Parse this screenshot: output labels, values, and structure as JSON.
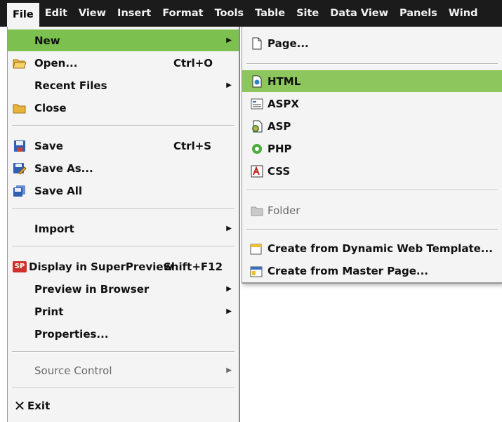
{
  "menubar": {
    "items": [
      "File",
      "Edit",
      "View",
      "Insert",
      "Format",
      "Tools",
      "Table",
      "Site",
      "Data View",
      "Panels",
      "Wind"
    ]
  },
  "file_menu": {
    "new": {
      "label": "New"
    },
    "open": {
      "label": "Open...",
      "shortcut": "Ctrl+O",
      "icon": "folder-open-icon"
    },
    "recent": {
      "label": "Recent Files"
    },
    "close": {
      "label": "Close",
      "icon": "folder-close-icon"
    },
    "save": {
      "label": "Save",
      "shortcut": "Ctrl+S",
      "icon": "floppy-disk-icon"
    },
    "save_as": {
      "label": "Save As...",
      "icon": "save-as-icon"
    },
    "save_all": {
      "label": "Save All",
      "icon": "save-all-icon"
    },
    "import": {
      "label": "Import"
    },
    "superpreview": {
      "label": "Display in SuperPreview",
      "shortcut": "Shift+F12",
      "icon": "superpreview-icon",
      "icon_text": "SP"
    },
    "preview": {
      "label": "Preview in Browser"
    },
    "print": {
      "label": "Print"
    },
    "properties": {
      "label": "Properties..."
    },
    "source_control": {
      "label": "Source Control"
    },
    "exit": {
      "label": "Exit",
      "icon": "close-x-icon"
    }
  },
  "new_submenu": {
    "page": {
      "label": "Page...",
      "icon": "page-icon"
    },
    "html": {
      "label": "HTML",
      "icon": "html-file-icon"
    },
    "aspx": {
      "label": "ASPX",
      "icon": "aspx-file-icon"
    },
    "asp": {
      "label": "ASP",
      "icon": "asp-file-icon"
    },
    "php": {
      "label": "PHP",
      "icon": "php-file-icon"
    },
    "css": {
      "label": "CSS",
      "icon": "css-file-icon"
    },
    "folder": {
      "label": "Folder",
      "icon": "folder-icon"
    },
    "dwt": {
      "label": "Create from Dynamic Web Template...",
      "icon": "dynamic-template-icon"
    },
    "master": {
      "label": "Create from Master Page...",
      "icon": "master-page-icon"
    }
  },
  "colors": {
    "menubar_bg": "#1b1b1b",
    "highlight": "#7cc14f",
    "menu_bg": "#f4f4f4"
  }
}
